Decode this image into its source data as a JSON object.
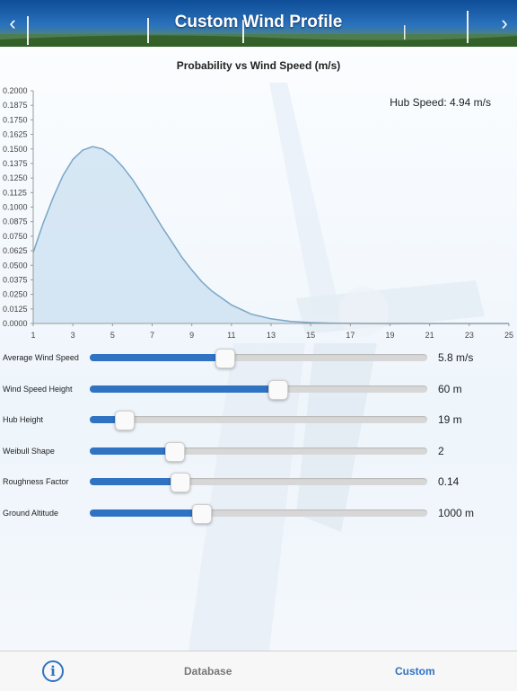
{
  "header": {
    "title": "Custom Wind Profile",
    "back_glyph": "‹",
    "forward_glyph": "›"
  },
  "chart_data": {
    "type": "area",
    "title": "Probability vs Wind Speed (m/s)",
    "xlabel": "",
    "ylabel": "",
    "x_ticks": [
      1,
      3,
      5,
      7,
      9,
      11,
      13,
      15,
      17,
      19,
      21,
      23,
      25
    ],
    "y_ticks": [
      "0.0000",
      "0.0125",
      "0.0250",
      "0.0375",
      "0.0500",
      "0.0625",
      "0.0750",
      "0.0875",
      "0.1000",
      "0.1125",
      "0.1250",
      "0.1375",
      "0.1500",
      "0.1625",
      "0.1750",
      "0.1875",
      "0.2000"
    ],
    "xlim": [
      1,
      25
    ],
    "ylim": [
      0,
      0.2
    ],
    "grid": false,
    "annotation": "Hub Speed: 4.94 m/s",
    "series": [
      {
        "x": [
          1,
          1.5,
          2,
          2.5,
          3,
          3.5,
          4,
          4.5,
          5,
          5.5,
          6,
          6.5,
          7,
          7.5,
          8,
          8.5,
          9,
          9.5,
          10,
          11,
          12,
          13,
          14,
          15,
          16,
          17,
          18,
          19,
          20,
          21,
          22,
          23,
          24,
          25
        ],
        "values": [
          0.061,
          0.086,
          0.108,
          0.127,
          0.141,
          0.149,
          0.152,
          0.15,
          0.144,
          0.135,
          0.124,
          0.111,
          0.097,
          0.083,
          0.07,
          0.057,
          0.046,
          0.036,
          0.028,
          0.016,
          0.008,
          0.004,
          0.0018,
          0.0008,
          0.0003,
          0.0001,
          0,
          0,
          0,
          0,
          0,
          0,
          0,
          0
        ]
      }
    ],
    "colors": {
      "line": "#7aa6c6",
      "fill": "#bcd7ec",
      "axis": "#999999",
      "tick_text": "#444444"
    }
  },
  "sliders": [
    {
      "id": "average-wind-speed",
      "label": "Average Wind Speed",
      "value_text": "5.8 m/s",
      "fraction": 0.4
    },
    {
      "id": "wind-speed-height",
      "label": "Wind Speed Height",
      "value_text": "60 m",
      "fraction": 0.555
    },
    {
      "id": "hub-height",
      "label": "Hub Height",
      "value_text": "19 m",
      "fraction": 0.1
    },
    {
      "id": "weibull-shape",
      "label": "Weibull Shape",
      "value_text": "2",
      "fraction": 0.25
    },
    {
      "id": "roughness-factor",
      "label": "Roughness Factor",
      "value_text": "0.14",
      "fraction": 0.265
    },
    {
      "id": "ground-altitude",
      "label": "Ground Altitude",
      "value_text": "1000 m",
      "fraction": 0.33
    }
  ],
  "tabs": {
    "info_glyph": "i",
    "database": "Database",
    "custom": "Custom"
  },
  "colors": {
    "accent": "#2f73c2",
    "inactive_tab": "#777777"
  }
}
